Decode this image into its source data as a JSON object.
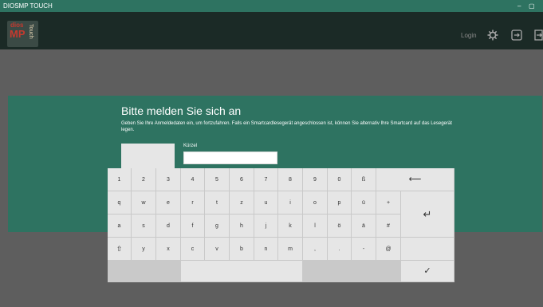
{
  "window": {
    "title": "DIOSMP TOUCH",
    "minimize": "–",
    "maximize": "▢"
  },
  "header": {
    "logo": {
      "top": "dios",
      "bottom": "MP",
      "side": "Touch"
    },
    "login": "Login",
    "icons": [
      "gear-icon",
      "exit-icon",
      "logout-icon"
    ]
  },
  "login_form": {
    "heading": "Bitte melden Sie sich an",
    "description": "Geben Sie Ihre Anmeldedaten ein, um fortzufahren. Falls ein Smartcardlesegerät angeschlossen ist, können Sie alternativ Ihre Smartcard auf das Lesegerät legen.",
    "kuerzel_label": "Kürzel",
    "kuerzel_value": ""
  },
  "keyboard": {
    "row1": [
      "1",
      "2",
      "3",
      "4",
      "5",
      "6",
      "7",
      "8",
      "9",
      "0",
      "ß"
    ],
    "backspace": "⟵",
    "row2": [
      "q",
      "w",
      "e",
      "r",
      "t",
      "z",
      "u",
      "i",
      "o",
      "p",
      "ü",
      "+"
    ],
    "row3": [
      "a",
      "s",
      "d",
      "f",
      "g",
      "h",
      "j",
      "k",
      "l",
      "ö",
      "ä",
      "#"
    ],
    "enter": "↵",
    "row4": [
      "⇧",
      "y",
      "x",
      "c",
      "v",
      "b",
      "n",
      "m",
      ",",
      ".",
      "-",
      "@"
    ],
    "confirm": "✓"
  }
}
